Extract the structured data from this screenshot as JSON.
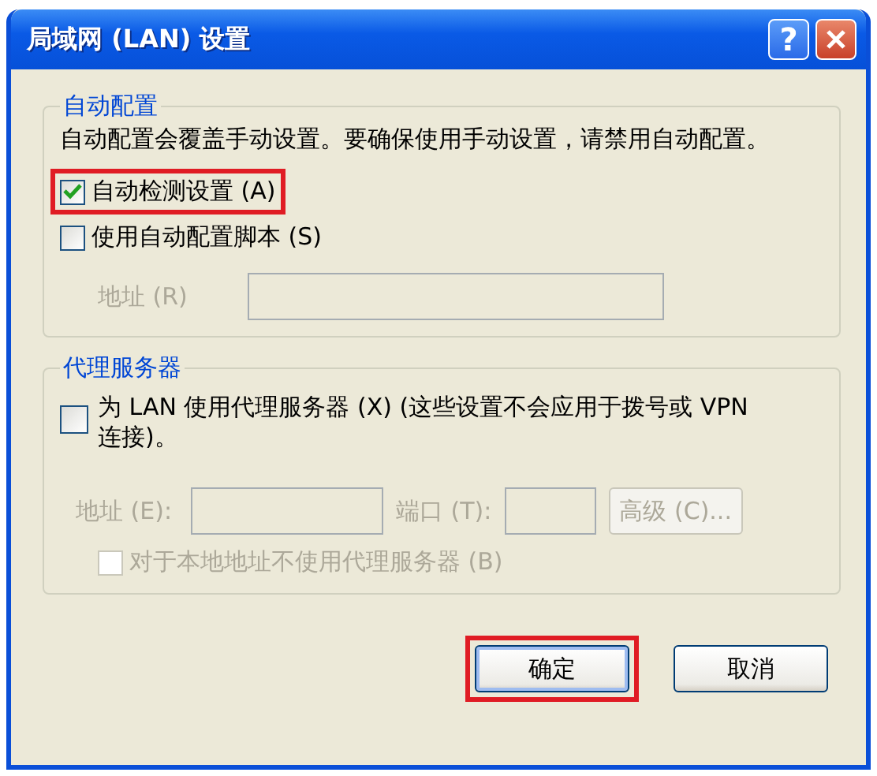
{
  "window": {
    "title": "局域网 (LAN) 设置",
    "help_label": "?"
  },
  "auto_config": {
    "title": "自动配置",
    "description": "自动配置会覆盖手动设置。要确保使用手动设置，请禁用自动配置。",
    "options": [
      {
        "label": "自动检测设置 (A)",
        "checked": true,
        "highlighted": true,
        "disabled": false
      },
      {
        "label": "使用自动配置脚本 (S)",
        "checked": false,
        "highlighted": false,
        "disabled": false
      }
    ],
    "address": {
      "label": "地址 (R)",
      "disabled": true
    }
  },
  "proxy": {
    "title": "代理服务器",
    "option": {
      "label": "为 LAN 使用代理服务器 (X) (这些设置不会应用于拨号或 VPN 连接)。",
      "checked": false,
      "disabled": false
    },
    "address": {
      "label": "地址 (E):",
      "disabled": true
    },
    "port": {
      "label": "端口 (T):",
      "disabled": true
    },
    "advanced": {
      "label": "高级 (C)...",
      "disabled": true
    },
    "bypass": {
      "label": "对于本地地址不使用代理服务器 (B)",
      "checked": false,
      "disabled": true
    }
  },
  "buttons": [
    {
      "label": "确定",
      "highlighted": true
    },
    {
      "label": "取消",
      "highlighted": false
    }
  ]
}
